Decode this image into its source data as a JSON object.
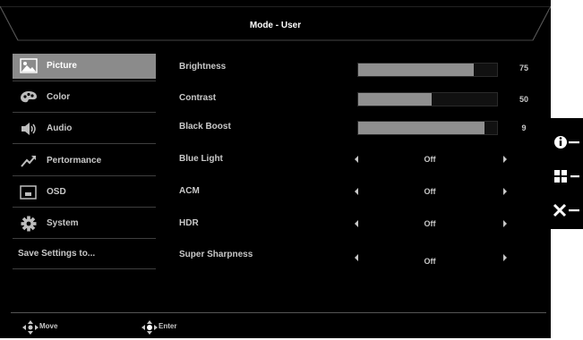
{
  "osd": {
    "title": "Mode - User",
    "sidebar": {
      "items": [
        {
          "label": "Picture",
          "icon": "picture-icon",
          "active": true
        },
        {
          "label": "Color",
          "icon": "palette-icon"
        },
        {
          "label": "Audio",
          "icon": "speaker-icon"
        },
        {
          "label": "Pertormance",
          "icon": "performance-icon"
        },
        {
          "label": "OSD",
          "icon": "osd-icon"
        },
        {
          "label": "System",
          "icon": "gear-icon"
        },
        {
          "label": "Save Settings to..."
        }
      ]
    },
    "settings": [
      {
        "label": "Brightness",
        "type": "slider",
        "value": 75,
        "fraction": 0.83
      },
      {
        "label": "Contrast",
        "type": "slider",
        "value": 50,
        "fraction": 0.53
      },
      {
        "label": "Black Boost",
        "type": "slider",
        "value": 9,
        "fraction": 0.91
      },
      {
        "label": "Blue Light",
        "type": "option",
        "value": "Off"
      },
      {
        "label": "ACM",
        "type": "option",
        "value": "Off"
      },
      {
        "label": "HDR",
        "type": "option",
        "value": "Off"
      },
      {
        "label": "Super Sharpness",
        "type": "option",
        "value": "Off"
      }
    ],
    "footer": {
      "move_label": "Move",
      "enter_label": "Enter"
    }
  },
  "side_panel": {
    "buttons": [
      {
        "icon": "info-icon"
      },
      {
        "icon": "grid-icon"
      },
      {
        "icon": "close-icon"
      }
    ]
  },
  "colors": {
    "background": "#000000",
    "active_item": "#8b8b8b",
    "bar_fill": "#8f8f8f",
    "text": "#c8c8c8"
  }
}
